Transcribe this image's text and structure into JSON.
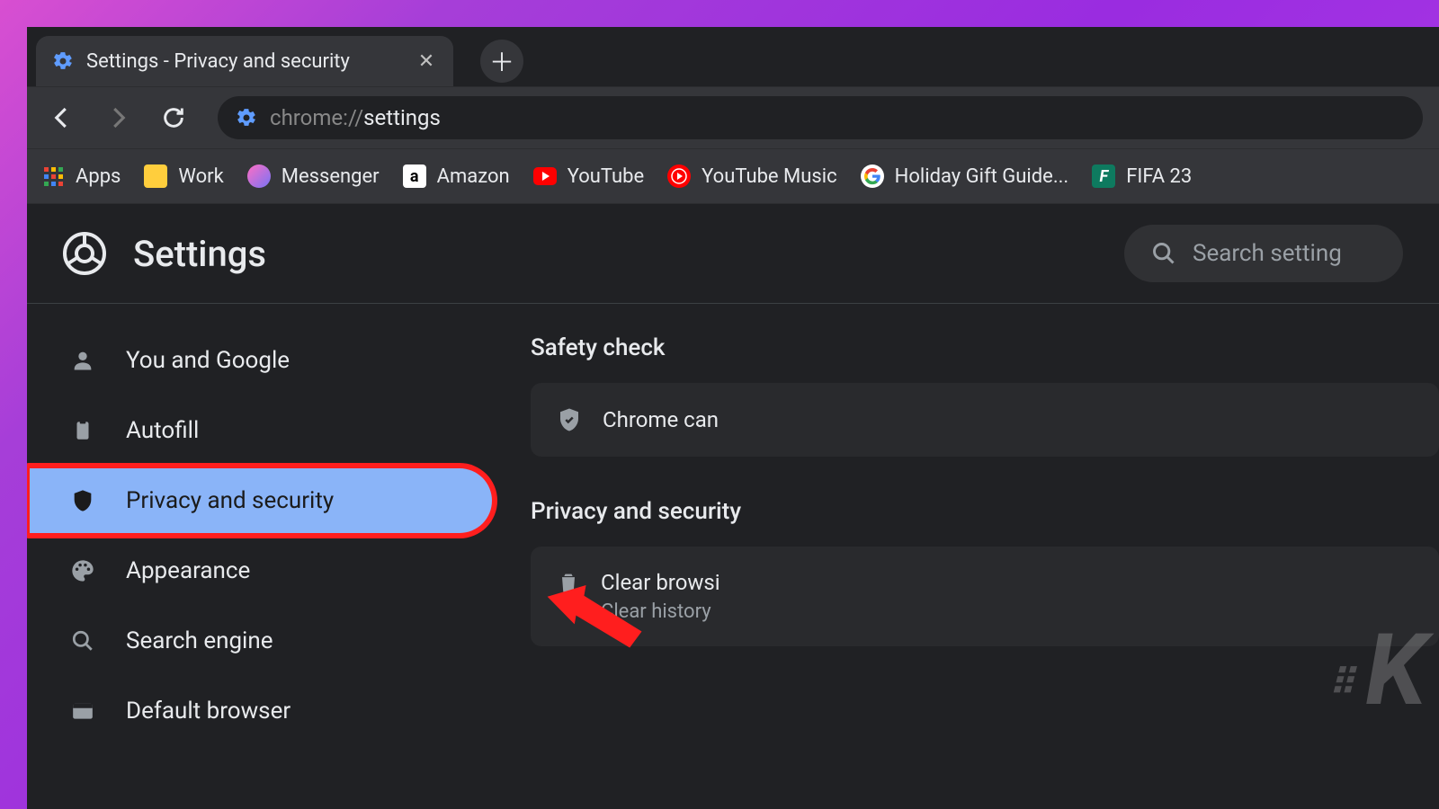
{
  "tab": {
    "title": "Settings - Privacy and security"
  },
  "address": {
    "scheme": "chrome://",
    "path": "settings"
  },
  "bookmarks": [
    {
      "label": "Apps"
    },
    {
      "label": "Work"
    },
    {
      "label": "Messenger"
    },
    {
      "label": "Amazon"
    },
    {
      "label": "YouTube"
    },
    {
      "label": "YouTube Music"
    },
    {
      "label": "Holiday Gift Guide..."
    },
    {
      "label": "FIFA 23"
    }
  ],
  "header": {
    "title": "Settings",
    "search_placeholder": "Search setting"
  },
  "sidebar": {
    "items": [
      {
        "label": "You and Google"
      },
      {
        "label": "Autofill"
      },
      {
        "label": "Privacy and security"
      },
      {
        "label": "Appearance"
      },
      {
        "label": "Search engine"
      },
      {
        "label": "Default browser"
      }
    ]
  },
  "panel": {
    "section1_title": "Safety check",
    "line1": "Chrome can",
    "section2_title": "Privacy and security",
    "clear_title": "Clear browsi",
    "clear_sub": "Clear history"
  }
}
